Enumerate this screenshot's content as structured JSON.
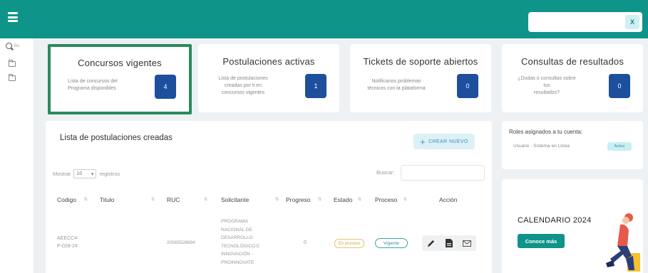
{
  "topbar": {
    "menu_icon": "hamburger-icon",
    "search_button": "X",
    "color": "#0e9488"
  },
  "sidebar": {
    "search_placeholder": "Bu",
    "folders": [
      "folder-icon",
      "folder-icon"
    ]
  },
  "stats": [
    {
      "title": "Concursos vigentes",
      "desc_lines": [
        "Lista de concursos del",
        "Programa disponibles"
      ],
      "count": "4"
    },
    {
      "title": "Postulaciones activas",
      "desc_lines": [
        "Lista de postulaciones",
        "creadas por ti en",
        "concursos vigentes"
      ],
      "count": "1"
    },
    {
      "title": "Tickets de soporte abiertos",
      "desc_lines": [
        "Notificanos problemas",
        "técnicos con la plataforma"
      ],
      "count": "0"
    },
    {
      "title": "Consultas de resultados",
      "desc_lines": [
        "¿Dudas o consultas sobre",
        "tus",
        "resultados?"
      ],
      "count": "0"
    }
  ],
  "list": {
    "title": "Lista de postulaciones creadas",
    "new_button": "CREAR NUEVO",
    "show_prefix": "Mostrar",
    "show_value": "10",
    "show_suffix": "registros",
    "search_label": "Buscar:",
    "columns": [
      "Codigo",
      "Titulo",
      "RUC",
      "Solicitante",
      "Progreso",
      "Estado",
      "Proceso",
      "Acción"
    ],
    "rows": [
      {
        "codigo_lines": [
          "AEECC4-",
          "P-028-24"
        ],
        "titulo": "",
        "ruc": "20565528694",
        "solicitante_lines": [
          "PROGRAMA",
          "NACIONAL DE",
          "DESARROLLO",
          "TECNOLÓGICO E",
          "INNOVACIÓN -",
          "PROINNOVATE"
        ],
        "progreso": "0",
        "estado": "En proceso",
        "proceso": "Vigente"
      }
    ]
  },
  "roles": {
    "title": "Roles asignados a tu cuenta:",
    "user": "Usuario - Sistema en Línea",
    "status": "Activo"
  },
  "calendar": {
    "title": "CALENDARIO 2024",
    "button": "Conoce más"
  }
}
